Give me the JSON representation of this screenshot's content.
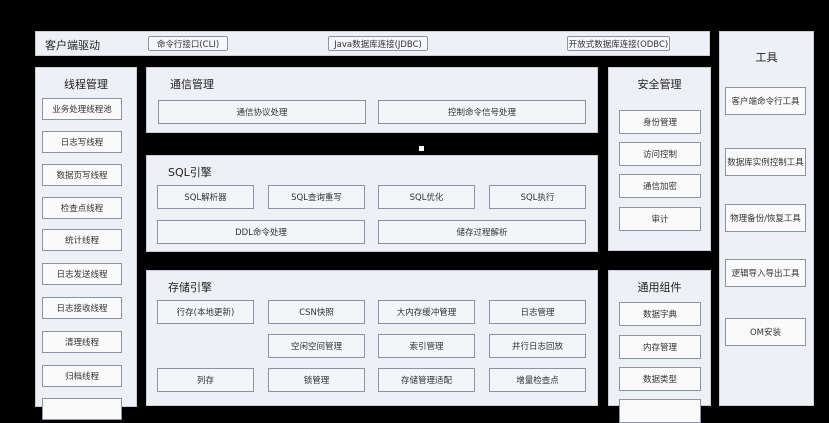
{
  "client_driver": {
    "title": "客户端驱动",
    "items": [
      "命令行接口(CLI)",
      "Java数据库连接(JDBC)",
      "开放式数据库连接(ODBC)"
    ]
  },
  "thread_mgmt": {
    "title": "线程管理",
    "items": [
      "业务处理线程池",
      "日志写线程",
      "数据页写线程",
      "检查点线程",
      "统计线程",
      "日志发送线程",
      "日志接收线程",
      "清理线程",
      "归档线程"
    ]
  },
  "comm_mgmt": {
    "title": "通信管理",
    "items": [
      "通信协议处理",
      "控制命令信号处理"
    ]
  },
  "sql_engine": {
    "title": "SQL引擎",
    "row1": [
      "SQL解析器",
      "SQL查询重写",
      "SQL优化",
      "SQL执行"
    ],
    "row2": [
      "DDL命令处理",
      "储存过程解析"
    ]
  },
  "storage_engine": {
    "title": "存储引擎",
    "row1": [
      "行存(本地更新)",
      "CSN快照",
      "大内存缓冲管理",
      "日志管理"
    ],
    "row2": [
      "空闲空间管理",
      "索引管理",
      "并行日志回放"
    ],
    "row3": [
      "列存",
      "锁管理",
      "存储管理适配",
      "增量检查点"
    ]
  },
  "security_mgmt": {
    "title": "安全管理",
    "items": [
      "身份管理",
      "访问控制",
      "通信加密",
      "审计"
    ]
  },
  "common_components": {
    "title": "通用组件",
    "items": [
      "数据字典",
      "内存管理",
      "数据类型"
    ]
  },
  "tools": {
    "title": "工具",
    "items": [
      "客户端命令行工具",
      "数据库实例控制工具",
      "物理备份/恢复工具",
      "逻辑导入导出工具",
      "OM安装"
    ]
  }
}
